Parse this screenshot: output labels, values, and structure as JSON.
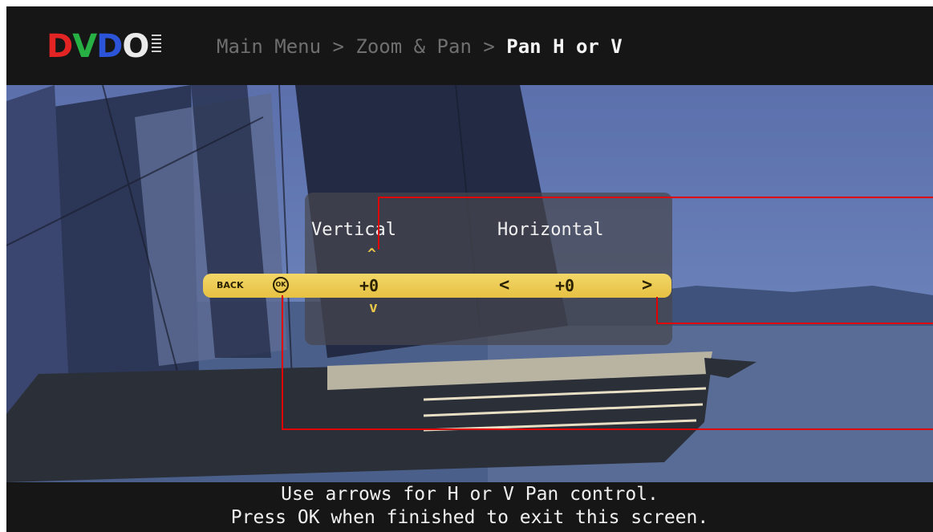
{
  "logo": {
    "text": [
      "D",
      "V",
      "D",
      "O"
    ],
    "colors": [
      "#e22424",
      "#27b043",
      "#2b54d8",
      "#eaeaea"
    ]
  },
  "breadcrumb": {
    "root": "Main Menu",
    "sep1": " > ",
    "middle": "Zoom & Pan",
    "sep2": " > ",
    "current": "Pan H or V"
  },
  "panel": {
    "vertical_label": "Vertical",
    "horizontal_label": "Horizontal",
    "back_label": "BACK",
    "ok_label": "OK",
    "vertical_value": "+0",
    "horizontal_value": "+0",
    "left_arrow": "<",
    "right_arrow": ">",
    "up_arrow": "^",
    "down_arrow": "v"
  },
  "footer": {
    "line1": "Use arrows for H or V Pan control.",
    "line2": "Press OK when finished to exit this screen."
  },
  "colors": {
    "accent_bar": "#e6c143",
    "callout": "#e00000",
    "background": "#161616"
  }
}
